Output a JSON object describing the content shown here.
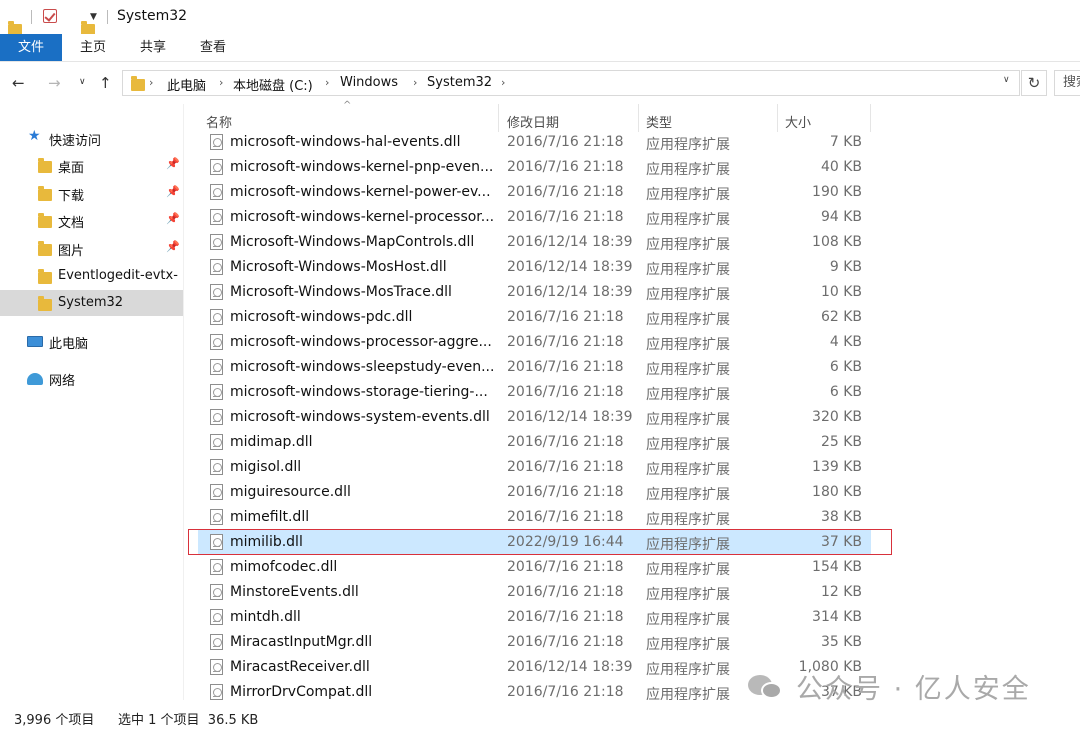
{
  "window": {
    "title": "System32"
  },
  "ribbon": {
    "tabs": [
      {
        "label": "文件"
      },
      {
        "label": "主页"
      },
      {
        "label": "共享"
      },
      {
        "label": "查看"
      }
    ]
  },
  "address": {
    "crumbs": [
      "此电脑",
      "本地磁盘 (C:)",
      "Windows",
      "System32"
    ],
    "search_placeholder": "搜索"
  },
  "sidebar": {
    "items": [
      {
        "label": "快速访问",
        "icon": "star-icon"
      },
      {
        "label": "桌面",
        "icon": "desktop-folder-icon",
        "pinned": true
      },
      {
        "label": "下载",
        "icon": "download-folder-icon",
        "pinned": true
      },
      {
        "label": "文档",
        "icon": "document-folder-icon",
        "pinned": true
      },
      {
        "label": "图片",
        "icon": "picture-folder-icon",
        "pinned": true
      },
      {
        "label": "Eventlogedit-evtx-",
        "icon": "folder-icon"
      },
      {
        "label": "System32",
        "icon": "folder-icon",
        "selected": true
      },
      {
        "label": "此电脑",
        "icon": "pc-icon"
      },
      {
        "label": "网络",
        "icon": "network-icon"
      }
    ]
  },
  "file_list": {
    "columns": {
      "name": "名称",
      "date": "修改日期",
      "type": "类型",
      "size": "大小"
    },
    "rows": [
      {
        "name": "microsoft-windows-hal-events.dll",
        "date": "2016/7/16 21:18",
        "type": "应用程序扩展",
        "size": "7 KB"
      },
      {
        "name": "microsoft-windows-kernel-pnp-even...",
        "date": "2016/7/16 21:18",
        "type": "应用程序扩展",
        "size": "40 KB"
      },
      {
        "name": "microsoft-windows-kernel-power-ev...",
        "date": "2016/7/16 21:18",
        "type": "应用程序扩展",
        "size": "190 KB"
      },
      {
        "name": "microsoft-windows-kernel-processor...",
        "date": "2016/7/16 21:18",
        "type": "应用程序扩展",
        "size": "94 KB"
      },
      {
        "name": "Microsoft-Windows-MapControls.dll",
        "date": "2016/12/14 18:39",
        "type": "应用程序扩展",
        "size": "108 KB"
      },
      {
        "name": "Microsoft-Windows-MosHost.dll",
        "date": "2016/12/14 18:39",
        "type": "应用程序扩展",
        "size": "9 KB"
      },
      {
        "name": "Microsoft-Windows-MosTrace.dll",
        "date": "2016/12/14 18:39",
        "type": "应用程序扩展",
        "size": "10 KB"
      },
      {
        "name": "microsoft-windows-pdc.dll",
        "date": "2016/7/16 21:18",
        "type": "应用程序扩展",
        "size": "62 KB"
      },
      {
        "name": "microsoft-windows-processor-aggre...",
        "date": "2016/7/16 21:18",
        "type": "应用程序扩展",
        "size": "4 KB"
      },
      {
        "name": "microsoft-windows-sleepstudy-even...",
        "date": "2016/7/16 21:18",
        "type": "应用程序扩展",
        "size": "6 KB"
      },
      {
        "name": "microsoft-windows-storage-tiering-...",
        "date": "2016/7/16 21:18",
        "type": "应用程序扩展",
        "size": "6 KB"
      },
      {
        "name": "microsoft-windows-system-events.dll",
        "date": "2016/12/14 18:39",
        "type": "应用程序扩展",
        "size": "320 KB"
      },
      {
        "name": "midimap.dll",
        "date": "2016/7/16 21:18",
        "type": "应用程序扩展",
        "size": "25 KB"
      },
      {
        "name": "migisol.dll",
        "date": "2016/7/16 21:18",
        "type": "应用程序扩展",
        "size": "139 KB"
      },
      {
        "name": "miguiresource.dll",
        "date": "2016/7/16 21:18",
        "type": "应用程序扩展",
        "size": "180 KB"
      },
      {
        "name": "mimefilt.dll",
        "date": "2016/7/16 21:18",
        "type": "应用程序扩展",
        "size": "38 KB"
      },
      {
        "name": "mimilib.dll",
        "date": "2022/9/19 16:44",
        "type": "应用程序扩展",
        "size": "37 KB",
        "selected": true
      },
      {
        "name": "mimofcodec.dll",
        "date": "2016/7/16 21:18",
        "type": "应用程序扩展",
        "size": "154 KB"
      },
      {
        "name": "MinstoreEvents.dll",
        "date": "2016/7/16 21:18",
        "type": "应用程序扩展",
        "size": "12 KB"
      },
      {
        "name": "mintdh.dll",
        "date": "2016/7/16 21:18",
        "type": "应用程序扩展",
        "size": "314 KB"
      },
      {
        "name": "MiracastInputMgr.dll",
        "date": "2016/7/16 21:18",
        "type": "应用程序扩展",
        "size": "35 KB"
      },
      {
        "name": "MiracastReceiver.dll",
        "date": "2016/12/14 18:39",
        "type": "应用程序扩展",
        "size": "1,080 KB"
      },
      {
        "name": "MirrorDrvCompat.dll",
        "date": "2016/7/16 21:18",
        "type": "应用程序扩展",
        "size": "37 KB"
      }
    ]
  },
  "status": {
    "item_count": "3,996 个项目",
    "selection": "选中 1 个项目  36.5 KB"
  },
  "watermark": {
    "text": "公众号 · 亿人安全"
  },
  "colors": {
    "accent": "#1a6fc4",
    "selection": "#cce8ff",
    "highlight_border": "#d8313b"
  }
}
